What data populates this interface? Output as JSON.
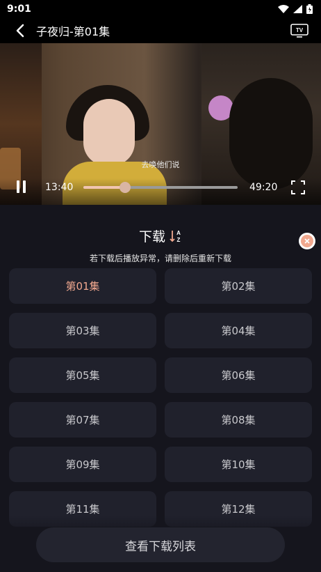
{
  "status": {
    "time": "9:01"
  },
  "header": {
    "title": "子夜归-第01集",
    "tv_label": "TV"
  },
  "player": {
    "subtitle": "去唤他们说",
    "current_time": "13:40",
    "total_time": "49:20",
    "progress": 0.27
  },
  "download": {
    "title": "下载",
    "hint": "若下载后播放异常，请删除后重新下载",
    "episodes": [
      "第01集",
      "第02集",
      "第03集",
      "第04集",
      "第05集",
      "第06集",
      "第07集",
      "第08集",
      "第09集",
      "第10集",
      "第11集",
      "第12集"
    ],
    "selected_index": 0,
    "view_list_label": "查看下载列表"
  },
  "colors": {
    "accent": "#f1a88f",
    "panel_bg": "#15151d",
    "tile_bg": "#20212c"
  }
}
